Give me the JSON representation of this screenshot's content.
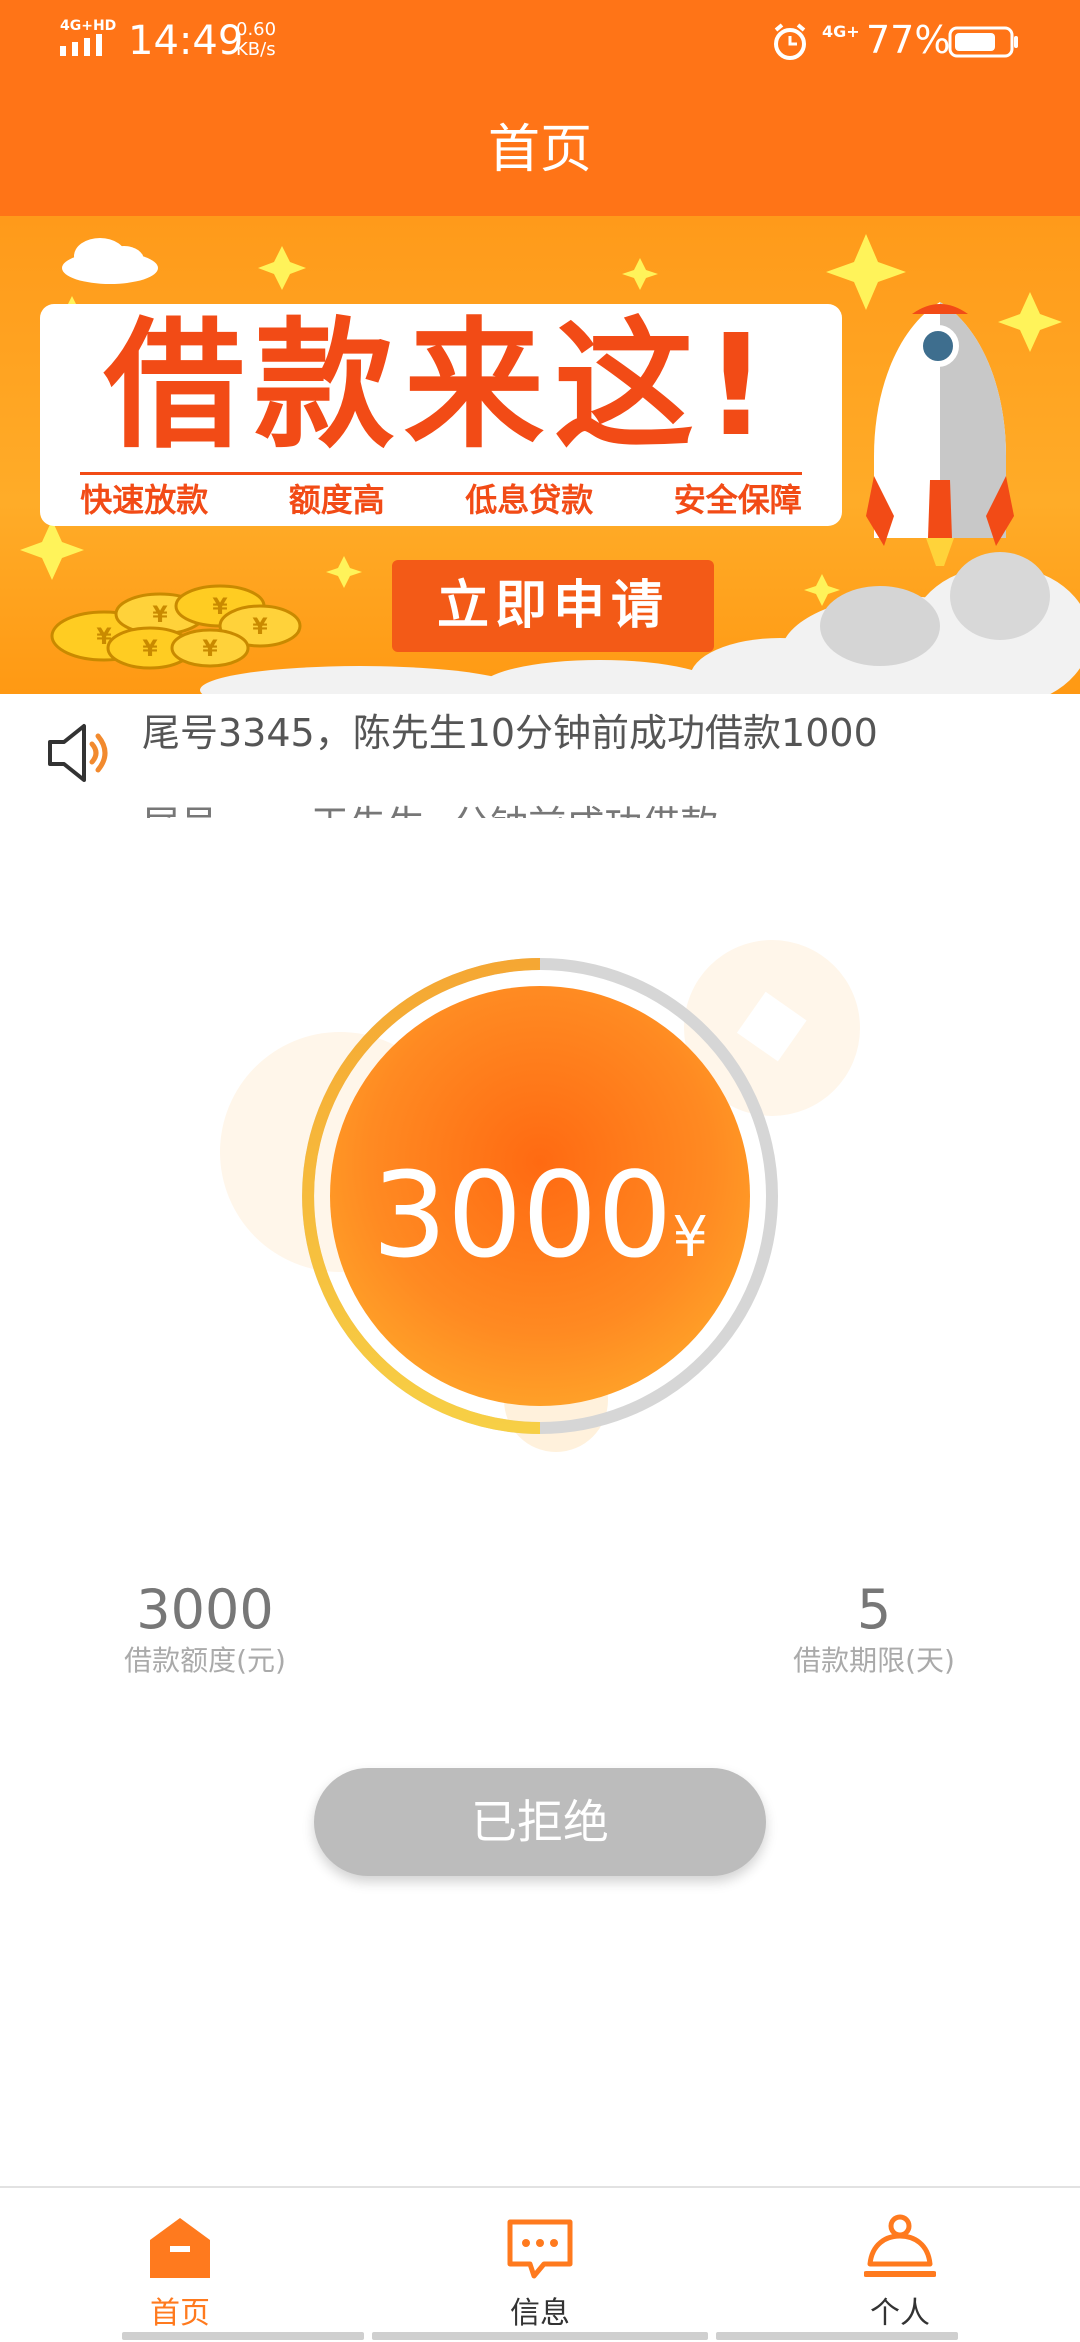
{
  "status_bar": {
    "network_label": "4G+HD",
    "time": "14:49",
    "speed_value": "0.60",
    "speed_unit": "KB/s",
    "cell_label": "4G+",
    "battery_percent": "77%",
    "battery_level": 0.77
  },
  "header": {
    "title": "首页"
  },
  "banner": {
    "headline": "借款来这!",
    "features": [
      "快速放款",
      "额度高",
      "低息贷款",
      "安全保障"
    ],
    "cta_label": "立即申请"
  },
  "notice": {
    "line1": "尾号3345，陈先生10分钟前成功借款1000",
    "line2": "尾号----，王先生--分钟前成功借款---"
  },
  "loan": {
    "amount": "3000",
    "currency": "¥",
    "progress": 0.5
  },
  "stats": {
    "amount_value": "3000",
    "amount_label": "借款额度(元)",
    "term_value": "5",
    "term_label": "借款期限(天)"
  },
  "status_button": {
    "label": "已拒绝"
  },
  "tabs": [
    {
      "label": "首页",
      "icon": "home-icon",
      "active": true
    },
    {
      "label": "信息",
      "icon": "message-icon",
      "active": false
    },
    {
      "label": "个人",
      "icon": "person-icon",
      "active": false
    }
  ],
  "colors": {
    "accent": "#ff7417",
    "banner_red": "#f24b16",
    "disabled": "#bcbcbc"
  }
}
